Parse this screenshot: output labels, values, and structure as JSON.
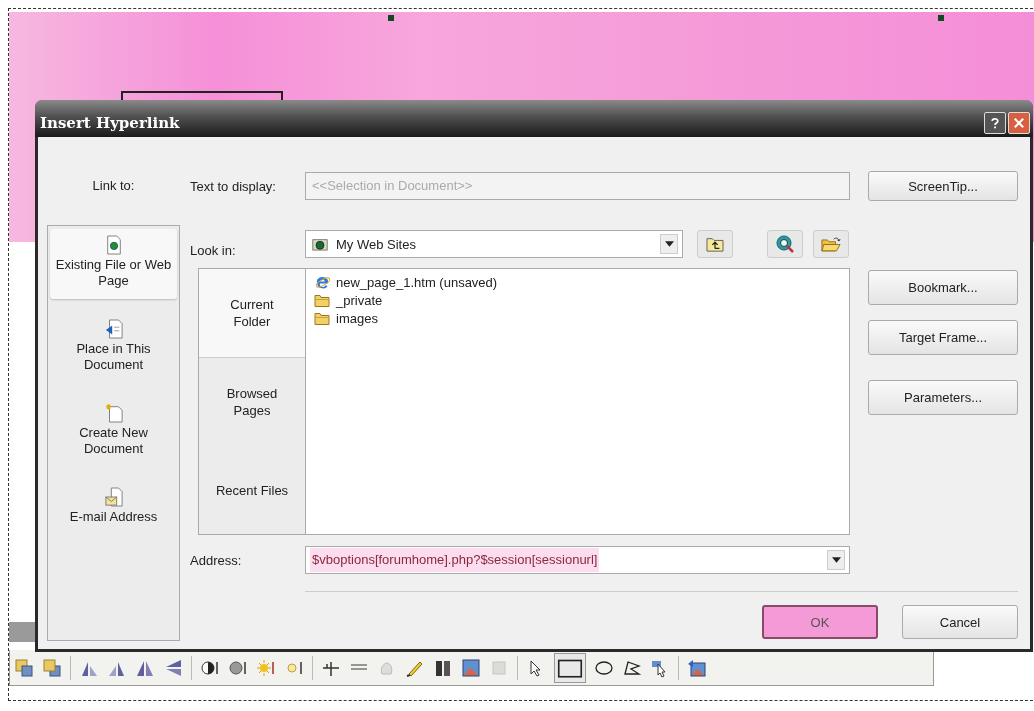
{
  "window": {
    "title": "Insert Hyperlink"
  },
  "link_to": {
    "label": "Link to:",
    "items": [
      {
        "label": "Existing File or Web Page",
        "kind": "file",
        "selected": true
      },
      {
        "label": "Place in This Document",
        "kind": "place",
        "selected": false
      },
      {
        "label": "Create New Document",
        "kind": "new",
        "selected": false
      },
      {
        "label": "E-mail Address",
        "kind": "email",
        "selected": false
      }
    ]
  },
  "text_to_display": {
    "label": "Text to display:",
    "value": "<<Selection in Document>>",
    "disabled": true
  },
  "look_in": {
    "label": "Look in:",
    "value": "My Web Sites"
  },
  "browse_tabs": [
    {
      "label": "Current Folder",
      "selected": true
    },
    {
      "label": "Browsed Pages",
      "selected": false
    },
    {
      "label": "Recent Files",
      "selected": false
    }
  ],
  "files": [
    {
      "name": "new_page_1.htm (unsaved)",
      "kind": "web-page"
    },
    {
      "name": "_private",
      "kind": "folder"
    },
    {
      "name": "images",
      "kind": "folder"
    }
  ],
  "address": {
    "label": "Address:",
    "value": "$vboptions[forumhome].php?$session[sessionurl]",
    "highlighted": true
  },
  "side_buttons": [
    {
      "label": "ScreenTip..."
    },
    {
      "label": "Bookmark..."
    },
    {
      "label": "Target Frame..."
    },
    {
      "label": "Parameters..."
    }
  ],
  "buttons": [
    {
      "label": "OK",
      "focused": true
    },
    {
      "label": "Cancel",
      "focused": false
    }
  ]
}
